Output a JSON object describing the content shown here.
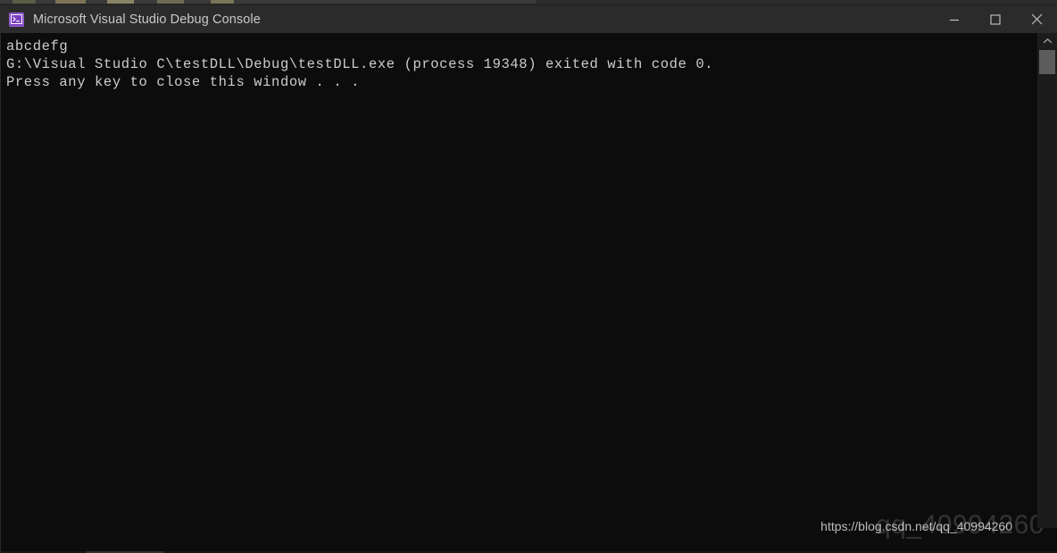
{
  "window": {
    "title": "Microsoft Visual Studio Debug Console",
    "icon": "console-app-icon",
    "titlebar_bg": "#2b2b2b",
    "title_color": "#c8c8c8",
    "body_bg": "#0c0c0c",
    "text_color": "#cccccc"
  },
  "window_controls": {
    "minimize": {
      "name": "minimize-button",
      "glyph": "minimize-icon",
      "label": "Minimize"
    },
    "maximize": {
      "name": "maximize-button",
      "glyph": "maximize-icon",
      "label": "Maximize"
    },
    "close": {
      "name": "close-button",
      "glyph": "close-icon",
      "label": "Close"
    }
  },
  "console": {
    "lines": [
      "abcdefg",
      "G:\\Visual Studio C\\testDLL\\Debug\\testDLL.exe (process 19348) exited with code 0.",
      "Press any key to close this window . . ."
    ],
    "output_text": "abcdefg\nG:\\Visual Studio C\\testDLL\\Debug\\testDLL.exe (process 19348) exited with code 0.\nPress any key to close this window . . .",
    "program_output": "abcdefg",
    "exit_path": "G:\\Visual Studio C\\testDLL\\Debug\\testDLL.exe",
    "process_id": "19348",
    "exit_code": "0",
    "prompt": "Press any key to close this window . . ."
  },
  "scrollbar": {
    "up_arrow": "chevron-up-icon",
    "down_arrow": "chevron-down-icon",
    "thumb_color": "#5c5c5c",
    "track_color": "#1c1c1c"
  },
  "watermark": {
    "url": "https://blog.csdn.net/qq_40994260",
    "overlay": "qq_40994260"
  }
}
